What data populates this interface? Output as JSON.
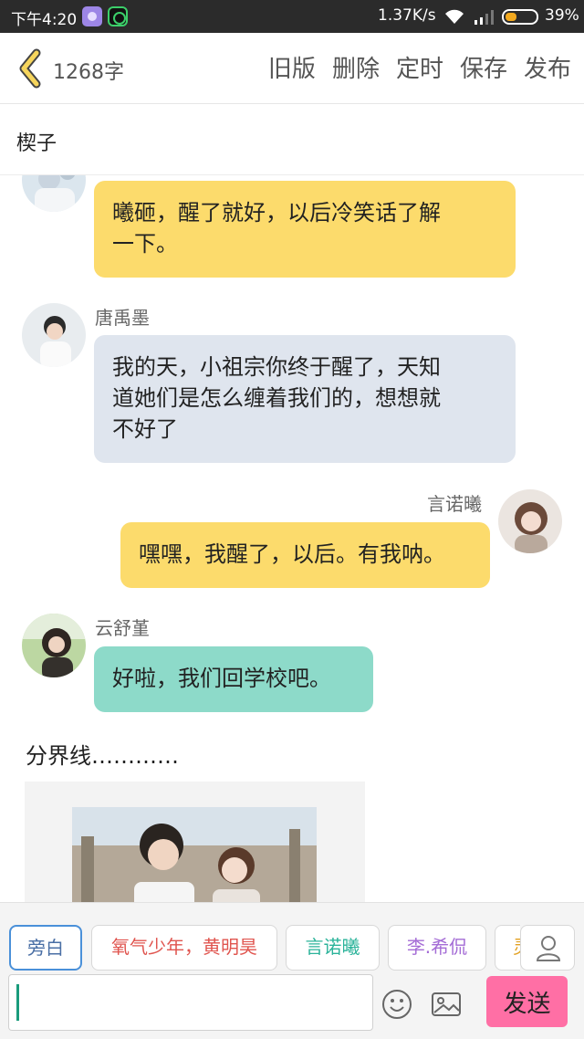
{
  "status_bar": {
    "time": "下午4:20",
    "network_speed": "1.37K/s",
    "battery": "39%",
    "battery_level": 0.39,
    "icons": [
      "app-icon",
      "app-icon",
      "wifi-icon",
      "signal-icon",
      "battery-icon"
    ]
  },
  "header": {
    "back_icon": "chevron-left-icon",
    "word_count": "1268字",
    "actions": [
      "旧版",
      "删除",
      "定时",
      "保存",
      "发布"
    ]
  },
  "chapter": {
    "title": "楔子"
  },
  "messages": [
    {
      "sender": "",
      "side": "left",
      "color": "#fcdb6c",
      "text_lines": [
        "曦砸，醒了就好，以后冷笑话了解",
        "一下。"
      ]
    },
    {
      "sender": "唐禹墨",
      "side": "left",
      "color": "#dfe5ee",
      "text_lines": [
        "我的天，小祖宗你终于醒了，天知",
        "道她们是怎么缠着我们的，想想就",
        "不好了"
      ]
    },
    {
      "sender": "言诺曦",
      "side": "right",
      "color": "#fcdb6c",
      "text_lines": [
        "嘿嘿，我醒了，以后。有我呐。"
      ]
    },
    {
      "sender": "云舒堇",
      "side": "left",
      "color": "#8ddac9",
      "text_lines": [
        "好啦，我们回学校吧。"
      ]
    }
  ],
  "narration": "分界线…………",
  "character_chips": [
    {
      "label": "旁白",
      "color": "#4a6fa5",
      "selected": true
    },
    {
      "label": "氧气少年，黄明昊",
      "color": "#e0554f",
      "selected": false
    },
    {
      "label": "言诺曦",
      "color": "#2bb39a",
      "selected": false
    },
    {
      "label": "李.希侃",
      "color": "#a46cd6",
      "selected": false
    },
    {
      "label": "灵",
      "color": "#e2a020",
      "selected": false
    }
  ],
  "composer": {
    "input_value": "",
    "send_label": "发送",
    "emoji_icon": "smiley-icon",
    "image_icon": "image-icon",
    "person_icon": "person-icon"
  },
  "colors": {
    "send": "#ff6fa5",
    "yellow_bubble": "#fcdb6c",
    "grey_bubble": "#dfe5ee",
    "teal_bubble": "#8ddac9"
  }
}
